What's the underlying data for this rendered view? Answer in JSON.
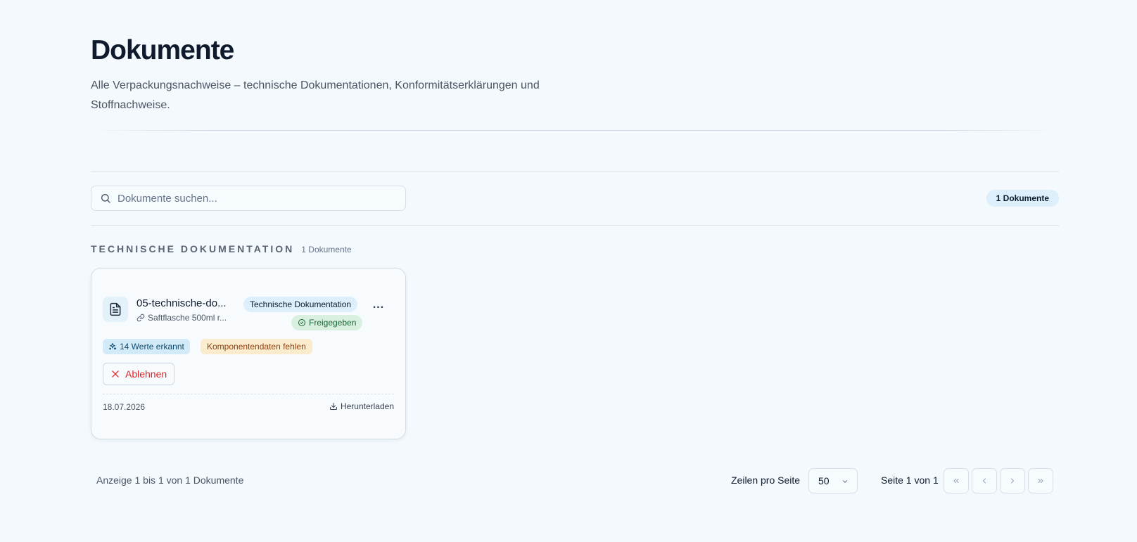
{
  "header": {
    "title": "Dokumente",
    "description": "Alle Verpackungsnachweise – technische Dokumentationen, Konformitätserklärungen und Stoffnachweise."
  },
  "toolbar": {
    "search_placeholder": "Dokumente suchen...",
    "count_badge": "1 Dokumente"
  },
  "sections": [
    {
      "title": "TECHNISCHE DOKUMENTATION",
      "count": "1 Dokumente",
      "documents": [
        {
          "name": "05-technische-do...",
          "linked_product": "Saftflasche 500ml r...",
          "type_tag": "Technische Dokumentation",
          "status": "Freigegeben",
          "values_tag": "14 Werte erkannt",
          "warning_tag": "Komponentendaten fehlen",
          "reject_label": "Ablehnen",
          "date": "18.07.2026",
          "download_label": "Herunterladen",
          "more_label": "..."
        }
      ]
    }
  ],
  "pagination": {
    "range_info": "Anzeige 1 bis 1 von 1 Dokumente",
    "rows_label": "Zeilen pro Seite",
    "rows_value": "50",
    "page_info": "Seite 1 von 1"
  },
  "icons": {
    "search": "search-icon",
    "document": "file-text-icon",
    "link": "link-icon",
    "status": "check-circle-icon",
    "values": "sparkles-icon",
    "reject": "x-icon",
    "download": "download-icon",
    "select": "chevron-down-icon",
    "first": "chevrons-left-icon",
    "prev": "chevron-left-icon",
    "next": "chevron-right-icon",
    "last": "chevrons-right-icon"
  },
  "colors": {
    "background": "#f3f9fd",
    "accent_badge": "#dceffa",
    "status_approved_bg": "#d9f0e0",
    "status_approved_text": "#166534",
    "warning_bg": "#fbeccd",
    "warning_text": "#92400e",
    "reject_text": "#dc2626"
  }
}
